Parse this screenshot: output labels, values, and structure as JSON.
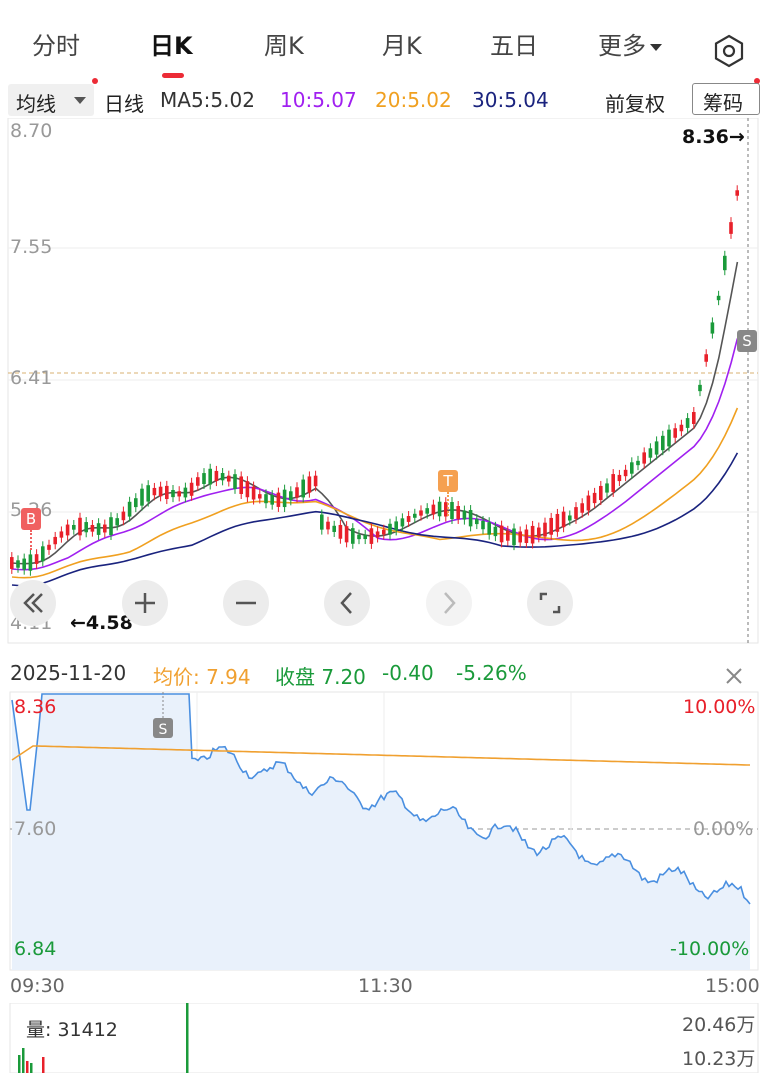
{
  "tabs": [
    {
      "label": "分时"
    },
    {
      "label": "日K"
    },
    {
      "label": "周K"
    },
    {
      "label": "月K"
    },
    {
      "label": "五日"
    },
    {
      "label": "更多"
    }
  ],
  "active_tab": "日K",
  "ma_bar": {
    "selector_label": "均线",
    "period_label": "日线",
    "ma5": "MA5:5.02",
    "ma10": "10:5.07",
    "ma20": "20:5.02",
    "ma30": "30:5.04",
    "adjust_label": "前复权",
    "chip_label": "筹码"
  },
  "colors": {
    "up": "#e8202a",
    "down": "#1a9a3a",
    "ma5": "#555555",
    "ma10": "#a020f0",
    "ma20": "#f0a020",
    "ma30": "#1a237e",
    "price_line": "#4a8fe0",
    "avg_line": "#f0a030",
    "accent": "#ec2b36"
  },
  "kchart": {
    "y_labels": {
      "top": "8.70",
      "mid1": "7.55",
      "mid2": "6.41",
      "mid3": "5.26",
      "bottom": "4.11"
    },
    "high_marker": "8.36→",
    "low_marker": "←4.58",
    "marker_b": "B",
    "marker_t": "T",
    "marker_s": "S"
  },
  "controls": [
    "rewind-icon",
    "zoom-in-icon",
    "zoom-out-icon",
    "prev-icon",
    "next-icon",
    "fullscreen-icon"
  ],
  "info": {
    "date": "2025-11-20",
    "avg_label": "均价: 7.94",
    "close_label": "收盘 7.20",
    "change": "-0.40",
    "change_pct": "-5.26%"
  },
  "intraday": {
    "price_high": "8.36",
    "price_mid": "7.60",
    "price_low": "6.84",
    "pct_high": "10.00%",
    "pct_mid": "0.00%",
    "pct_low": "-10.00%",
    "time_start": "09:30",
    "time_mid": "11:30",
    "time_end": "15:00",
    "marker_s": "S"
  },
  "volume": {
    "label": "量: 31412",
    "max_label": "20.46万",
    "mid_label": "10.23万"
  }
}
